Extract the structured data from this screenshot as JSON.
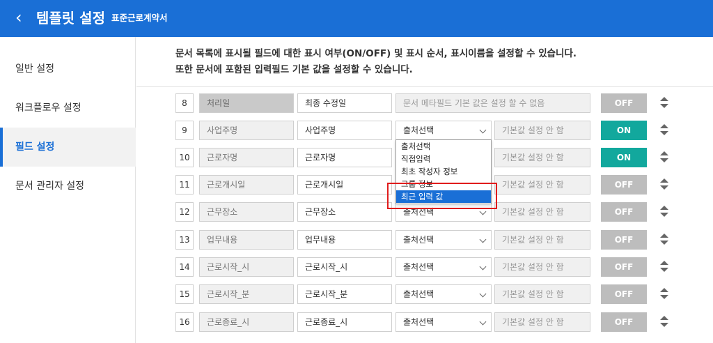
{
  "header": {
    "title": "템플릿 설정",
    "subtitle": "표준근로계약서",
    "back_icon": "chevron-left-icon"
  },
  "sidebar": {
    "items": [
      {
        "label": "일반 설정",
        "active": false
      },
      {
        "label": "워크플로우 설정",
        "active": false
      },
      {
        "label": "필드 설정",
        "active": true
      },
      {
        "label": "문서 관리자 설정",
        "active": false
      }
    ]
  },
  "description": {
    "line1": "문서 목록에 표시될 필드에 대한 표시 여부(ON/OFF) 및 표시 순서, 표시이름을 설정할 수 있습니다.",
    "line2": "또한 문서에 포함된 입력필드 기본 값을 설정할 수 있습니다."
  },
  "rows": [
    {
      "num": "8",
      "field": "처리일",
      "display": "최종 수정일",
      "source": "문서 메타필드 기본 값은 설정 할 수 없음",
      "default": "",
      "toggle": "OFF"
    },
    {
      "num": "9",
      "field": "사업주명",
      "display": "사업주명",
      "source": "출처선택",
      "default": "기본값 설정 안 함",
      "toggle": "ON"
    },
    {
      "num": "10",
      "field": "근로자명",
      "display": "근로자명",
      "source": "",
      "default": "기본값 설정 안 함",
      "toggle": "ON"
    },
    {
      "num": "11",
      "field": "근로개시일",
      "display": "근로개시일",
      "source": "",
      "default": "기본값 설정 안 함",
      "toggle": "OFF"
    },
    {
      "num": "12",
      "field": "근무장소",
      "display": "근무장소",
      "source": "출처선택",
      "default": "기본값 설정 안 함",
      "toggle": "OFF"
    },
    {
      "num": "13",
      "field": "업무내용",
      "display": "업무내용",
      "source": "출처선택",
      "default": "기본값 설정 안 함",
      "toggle": "OFF"
    },
    {
      "num": "14",
      "field": "근로시작_시",
      "display": "근로시작_시",
      "source": "출처선택",
      "default": "기본값 설정 안 함",
      "toggle": "OFF"
    },
    {
      "num": "15",
      "field": "근로시작_분",
      "display": "근로시작_분",
      "source": "출처선택",
      "default": "기본값 설정 안 함",
      "toggle": "OFF"
    },
    {
      "num": "16",
      "field": "근로종료_시",
      "display": "근로종료_시",
      "source": "출처선택",
      "default": "기본값 설정 안 함",
      "toggle": "OFF"
    }
  ],
  "dropdown": {
    "options": [
      "출처선택",
      "직접입력",
      "최초 작성자 정보",
      "그룹 정보",
      "최근 입력 값"
    ],
    "selected_index": 4
  },
  "colors": {
    "header": "#1a6fd6",
    "toggle_on": "#12a89d",
    "toggle_off": "#bdbdbd",
    "highlight": "#e01c1c"
  }
}
